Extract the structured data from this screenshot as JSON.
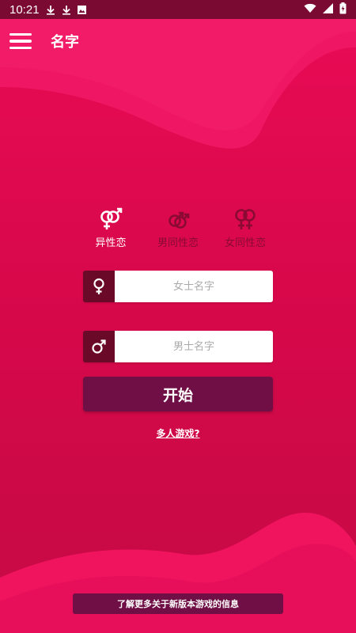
{
  "status_bar": {
    "time": "10:21"
  },
  "app_bar": {
    "title": "名字"
  },
  "modes": [
    {
      "label": "异性恋",
      "icon": "heterosexual-symbol-icon",
      "active": true
    },
    {
      "label": "男同性恋",
      "icon": "gay-symbol-icon",
      "active": false
    },
    {
      "label": "女同性恋",
      "icon": "lesbian-symbol-icon",
      "active": false
    }
  ],
  "inputs": {
    "female_name": {
      "placeholder": "女士名字",
      "value": "",
      "icon": "female-symbol-icon"
    },
    "male_name": {
      "placeholder": "男士名字",
      "value": "",
      "icon": "male-symbol-icon"
    }
  },
  "start_button": {
    "label": "开始"
  },
  "multiplayer_link": {
    "label": "多人游戏?"
  },
  "info_banner": {
    "label": "了解更多关于新版本游戏的信息"
  },
  "colors": {
    "background": "#e00a50",
    "status_bar": "#7a0a31",
    "button": "#6f0f45",
    "icon_box": "#6a0a28",
    "inactive_mode": "#8a0a35"
  }
}
